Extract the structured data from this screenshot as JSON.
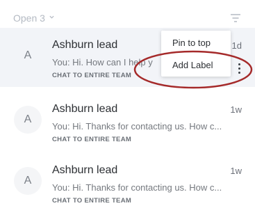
{
  "header": {
    "open_label": "Open 3",
    "icons": {
      "chevron": "chevron-down-icon",
      "filter": "filter-lines-icon"
    }
  },
  "conversations": [
    {
      "avatar": "A",
      "name": "Ashburn lead",
      "time": "1d",
      "preview": "You: Hi. How can I help y",
      "team": "CHAT TO ENTIRE TEAM"
    },
    {
      "avatar": "A",
      "name": "Ashburn lead",
      "time": "1w",
      "preview": "You: Hi. Thanks for contacting us. How c...",
      "team": "CHAT TO ENTIRE TEAM"
    },
    {
      "avatar": "A",
      "name": "Ashburn lead",
      "time": "1w",
      "preview": "You: Hi. Thanks for contacting us. How c...",
      "team": "CHAT TO ENTIRE TEAM"
    }
  ],
  "context_menu": {
    "items": [
      {
        "label": "Pin to top"
      },
      {
        "label": "Add Label"
      }
    ]
  },
  "colors": {
    "annotation": "#a52a2a",
    "hover_row": "#f2f4f8"
  }
}
